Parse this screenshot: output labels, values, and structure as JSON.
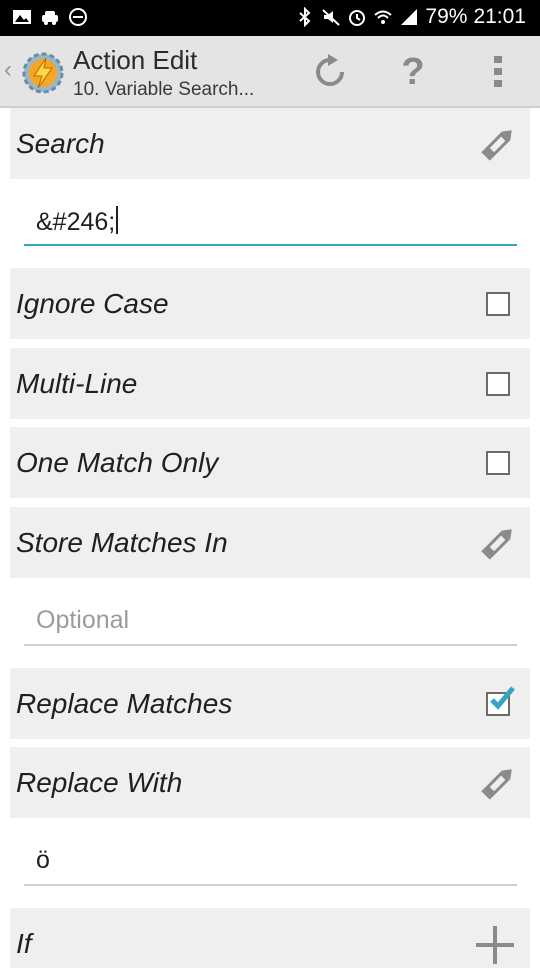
{
  "status_bar": {
    "battery": "79%",
    "time": "21:01",
    "icons_left": [
      "image-icon",
      "car-icon",
      "do-not-disturb-icon"
    ],
    "icons_right": [
      "bluetooth-icon",
      "mute-icon",
      "alarm-icon",
      "wifi-icon",
      "signal-icon"
    ]
  },
  "action_bar": {
    "title": "Action Edit",
    "subtitle": "10. Variable Search...",
    "buttons": [
      "reset-icon",
      "help-icon",
      "overflow-menu-icon"
    ],
    "help_glyph": "?"
  },
  "rows": {
    "search": {
      "label": "Search",
      "value": "&#246;"
    },
    "ignore_case": {
      "label": "Ignore Case",
      "checked": false
    },
    "multi_line": {
      "label": "Multi-Line",
      "checked": false
    },
    "one_match_only": {
      "label": "One Match Only",
      "checked": false
    },
    "store_matches_in": {
      "label": "Store Matches In",
      "placeholder": "Optional"
    },
    "replace_matches": {
      "label": "Replace Matches",
      "checked": true
    },
    "replace_with": {
      "label": "Replace With",
      "value": "ö"
    },
    "if": {
      "label": "If"
    }
  },
  "colors": {
    "accent": "#35a5c1",
    "row_background": "#efefef",
    "action_bar": "#e4e4e4",
    "icon_gray": "#8a8a8a"
  }
}
